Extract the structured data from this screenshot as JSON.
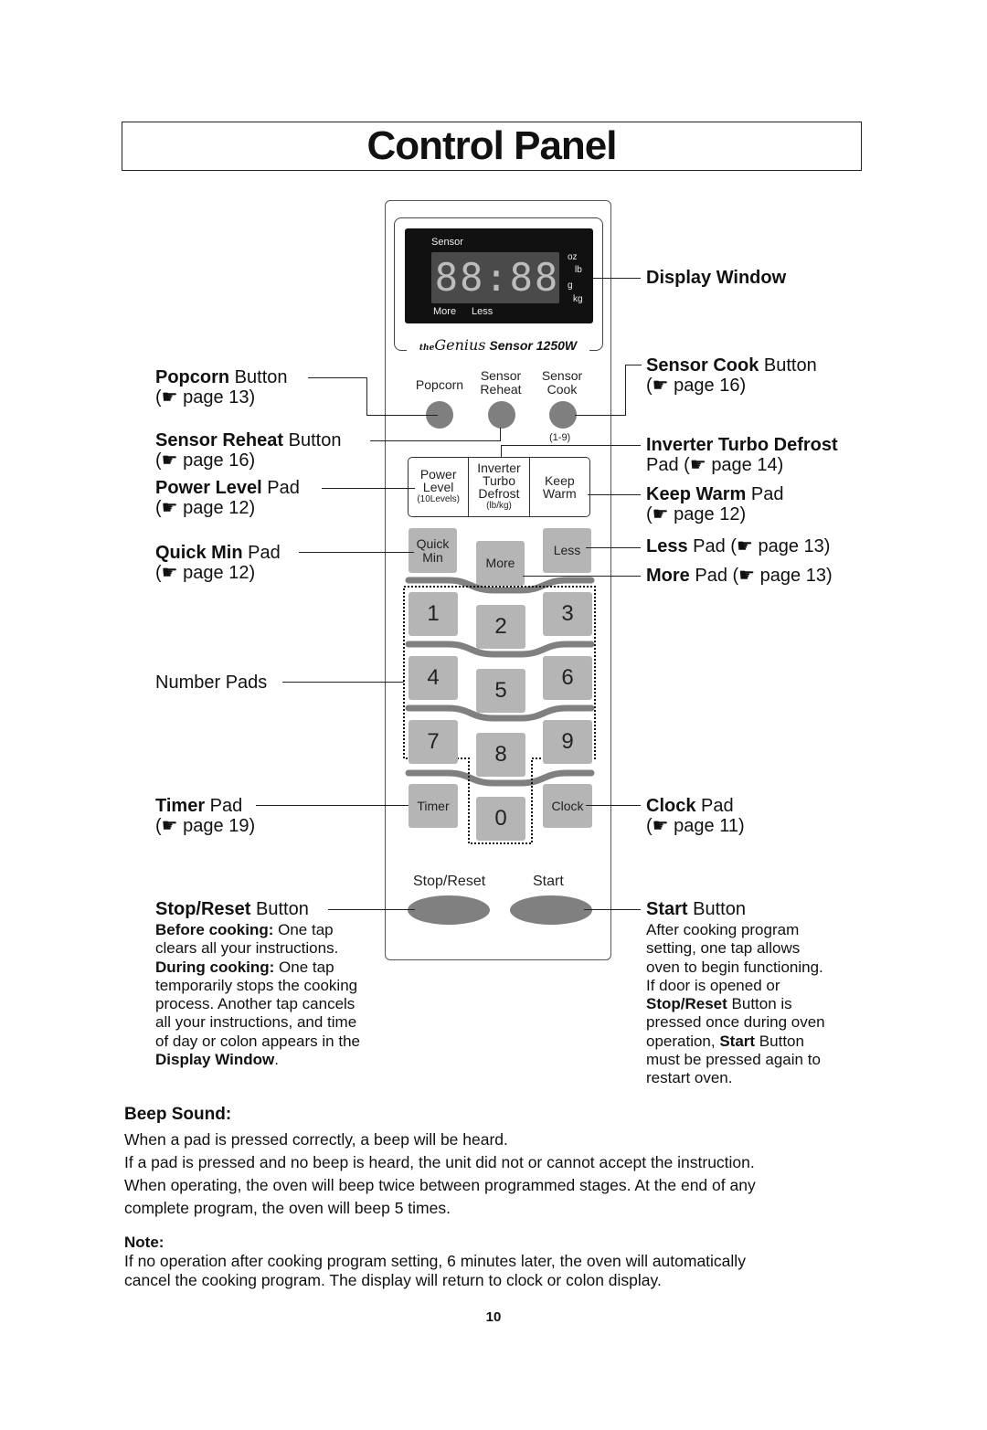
{
  "page": {
    "title": "Control Panel",
    "page_number": "10"
  },
  "panel": {
    "display": {
      "sensor_label": "Sensor",
      "digits": "88:88",
      "more_label": "More",
      "less_label": "Less",
      "unit_oz": "oz",
      "unit_lb": "lb",
      "unit_g": "g",
      "unit_kg": "kg"
    },
    "brand": {
      "prefix": "the",
      "name": "Genius",
      "model": "Sensor 1250W"
    },
    "top_buttons": [
      {
        "label": "Popcorn"
      },
      {
        "label_line1": "Sensor",
        "label_line2": "Reheat"
      },
      {
        "label_line1": "Sensor",
        "label_line2": "Cook"
      }
    ],
    "sensor_cook_range": "(1-9)",
    "trio": [
      {
        "line1": "Power",
        "line2": "Level",
        "sub": "(10Levels)"
      },
      {
        "line1": "Inverter",
        "line2": "Turbo",
        "line3": "Defrost",
        "sub": "(lb/kg)"
      },
      {
        "line1": "Keep",
        "line2": "Warm"
      }
    ],
    "quick_min": {
      "line1": "Quick",
      "line2": "Min"
    },
    "more": "More",
    "less": "Less",
    "numbers": [
      "1",
      "2",
      "3",
      "4",
      "5",
      "6",
      "7",
      "8",
      "9",
      "0"
    ],
    "timer": "Timer",
    "clock": "Clock",
    "stop_reset": "Stop/Reset",
    "start": "Start"
  },
  "callouts": {
    "left": [
      {
        "bold": "Popcorn",
        "rest": " Button",
        "ref": "page 13"
      },
      {
        "bold": "Sensor Reheat",
        "rest": " Button",
        "ref": "page 16"
      },
      {
        "bold": "Power Level",
        "rest": " Pad",
        "ref": "page 12"
      },
      {
        "bold": "Quick Min",
        "rest": " Pad",
        "ref": "page 12"
      },
      {
        "bold": "",
        "rest": "Number Pads",
        "ref": ""
      },
      {
        "bold": "Timer",
        "rest": " Pad",
        "ref": "page 19"
      }
    ],
    "right": [
      {
        "bold": "Display Window",
        "rest": "",
        "ref": ""
      },
      {
        "bold": "Sensor Cook",
        "rest": " Button",
        "ref": "page 16"
      },
      {
        "bold": "Inverter Turbo Defrost",
        "rest": "",
        "line2": "Pad (",
        "ref": "page 14"
      },
      {
        "bold": "Keep Warm",
        "rest": " Pad",
        "ref": "page 12"
      },
      {
        "bold": "Less",
        "rest": " Pad (",
        "ref": "page 13"
      },
      {
        "bold": "More",
        "rest": " Pad (",
        "ref": "page 13"
      },
      {
        "bold": "Clock",
        "rest": " Pad",
        "ref": "page 11"
      }
    ],
    "pointer_icon": "☛",
    "stop_reset": {
      "heading_bold": "Stop/Reset",
      "heading_rest": " Button",
      "before_bold": "Before cooking:",
      "before_rest": " One tap",
      "lines": [
        "clears all your instructions."
      ],
      "during_bold": "During cooking:",
      "during_rest": " One tap",
      "lines2": [
        "temporarily stops the cooking",
        "process. Another tap cancels",
        "all your instructions, and time",
        "of day or colon appears in the"
      ],
      "end_bold": "Display Window",
      "end_rest": "."
    },
    "start": {
      "heading_bold": "Start",
      "heading_rest": " Button",
      "lines": [
        "After cooking program",
        "setting, one tap allows",
        "oven to begin functioning.",
        "If door is opened or"
      ],
      "l5_bold": "Stop/Reset",
      "l5_rest": " Button is",
      "l6": "pressed once during oven",
      "l7_pre": "operation, ",
      "l7_bold": "Start",
      "l7_rest": " Button",
      "lines3": [
        "must be pressed again to",
        "restart oven."
      ]
    }
  },
  "beep": {
    "heading": "Beep Sound:",
    "paragraphs": [
      "When a pad is pressed correctly, a beep will be heard.",
      "If a pad is pressed and no beep is heard, the unit did not or cannot accept the instruction.",
      "When operating, the oven will beep twice between programmed stages. At the end of any",
      "complete program, the oven will beep 5 times."
    ]
  },
  "note": {
    "heading": "Note:",
    "lines": [
      "If no operation after cooking program setting, 6 minutes later, the oven will automatically",
      "cancel the cooking program. The display will return to clock or colon display."
    ]
  }
}
